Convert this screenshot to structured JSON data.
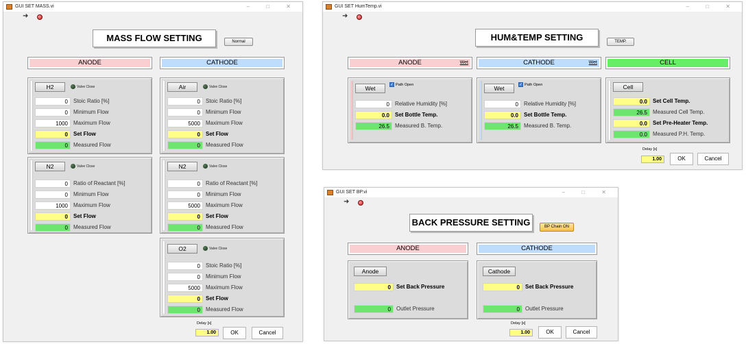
{
  "colors": {
    "anode": "#f9cfd2",
    "cathode": "#bedcfb",
    "cell": "#66ee66",
    "set_value": "#ffff88",
    "measured_value": "#6ee56e"
  },
  "icons": {
    "run": "run-arrow-icon",
    "stop": "stop-icon",
    "valve_led": "led-indicator",
    "checkbox": "checkbox-checked"
  },
  "win_controls": "–  □  ✕",
  "mass": {
    "title": "GUI SET MASS.vi",
    "heading": "MASS FLOW SETTING",
    "mode_btn": "Normal",
    "anode_label": "ANODE",
    "cathode_label": "CATHODE",
    "h2": {
      "name": "H2",
      "valve": "Valve Close",
      "rows": [
        {
          "v": "0",
          "l": "Stoic Ratio [%]"
        },
        {
          "v": "0",
          "l": "Minimum Flow"
        },
        {
          "v": "1000",
          "l": "Maximum Flow"
        },
        {
          "v": "0",
          "l": "Set Flow"
        },
        {
          "v": "0",
          "l": "Measured Flow"
        }
      ]
    },
    "n2a": {
      "name": "N2",
      "valve": "Valve Close",
      "rows": [
        {
          "v": "0",
          "l": "Ratio of Reactant [%]"
        },
        {
          "v": "0",
          "l": "Minimum Flow"
        },
        {
          "v": "1000",
          "l": "Maximum Flow"
        },
        {
          "v": "0",
          "l": "Set Flow"
        },
        {
          "v": "0",
          "l": "Measured Flow"
        }
      ]
    },
    "air": {
      "name": "Air",
      "valve": "Valve Close",
      "rows": [
        {
          "v": "0",
          "l": "Stoic Ratio [%]"
        },
        {
          "v": "0",
          "l": "Minimum Flow"
        },
        {
          "v": "5000",
          "l": "Maximum Flow"
        },
        {
          "v": "0",
          "l": "Set Flow"
        },
        {
          "v": "0",
          "l": "Measured Flow"
        }
      ]
    },
    "n2c": {
      "name": "N2",
      "valve": "Valve Close",
      "rows": [
        {
          "v": "0",
          "l": "Ratio of Reactant [%]"
        },
        {
          "v": "0",
          "l": "Minimum Flow"
        },
        {
          "v": "5000",
          "l": "Maximum Flow"
        },
        {
          "v": "0",
          "l": "Set Flow"
        },
        {
          "v": "0",
          "l": "Measured Flow"
        }
      ]
    },
    "o2": {
      "name": "O2",
      "valve": "Valve Close",
      "rows": [
        {
          "v": "0",
          "l": "Stoic Ratio [%]"
        },
        {
          "v": "0",
          "l": "Minimum Flow"
        },
        {
          "v": "5000",
          "l": "Maximum Flow"
        },
        {
          "v": "0",
          "l": "Set Flow"
        },
        {
          "v": "0",
          "l": "Measured Flow"
        }
      ]
    },
    "delay_label": "Delay [s]",
    "delay_value": "1.00",
    "ok": "OK",
    "cancel": "Cancel"
  },
  "hum": {
    "title": "GUI SET HumTemp.vi",
    "heading": "HUM&TEMP  SETTING",
    "mode_btn": "TEMP.",
    "anode_label": "ANODE",
    "cathode_label": "CATHODE",
    "cell_label": "CELL",
    "wet_link": "Wet",
    "anode": {
      "name": "Wet",
      "path": "Path Open",
      "rows": [
        {
          "v": "0",
          "l": "Relative Humidity [%]"
        },
        {
          "v": "0.0",
          "l": "Set Bottle Temp."
        },
        {
          "v": "26.5",
          "l": "Measured B. Temp."
        }
      ]
    },
    "cathode": {
      "name": "Wet",
      "path": "Path Open",
      "rows": [
        {
          "v": "0",
          "l": "Relative Humidity [%]"
        },
        {
          "v": "0.0",
          "l": "Set Bottle Temp."
        },
        {
          "v": "26.5",
          "l": "Measured B. Temp."
        }
      ]
    },
    "cell": {
      "name": "Cell",
      "rows": [
        {
          "v": "0.0",
          "l": "Set Cell Temp."
        },
        {
          "v": "26.5",
          "l": "Measured Cell Temp."
        },
        {
          "v": "0.0",
          "l": "Set Pre-Heater Temp."
        },
        {
          "v": "0.0",
          "l": "Measured P.H. Temp."
        }
      ]
    },
    "delay_label": "Delay [s]",
    "delay_value": "1.00",
    "ok": "OK",
    "cancel": "Cancel"
  },
  "bp": {
    "title": "GUI SET BP.vi",
    "heading": "BACK PRESSURE SETTING",
    "mode_btn": "BP Chain ON",
    "anode_label": "ANODE",
    "cathode_label": "CATHODE",
    "anode": {
      "name": "Anode",
      "rows": [
        {
          "v": "0",
          "l": "Set Back Pressure"
        },
        {
          "v": "0",
          "l": "Outlet Pressure"
        }
      ]
    },
    "cathode": {
      "name": "Cathode",
      "rows": [
        {
          "v": "0",
          "l": "Set Back Pressure"
        },
        {
          "v": "0",
          "l": "Outlet Pressure"
        }
      ]
    },
    "delay_label": "Delay [s]",
    "delay_value": "1.00",
    "ok": "OK",
    "cancel": "Cancel"
  }
}
